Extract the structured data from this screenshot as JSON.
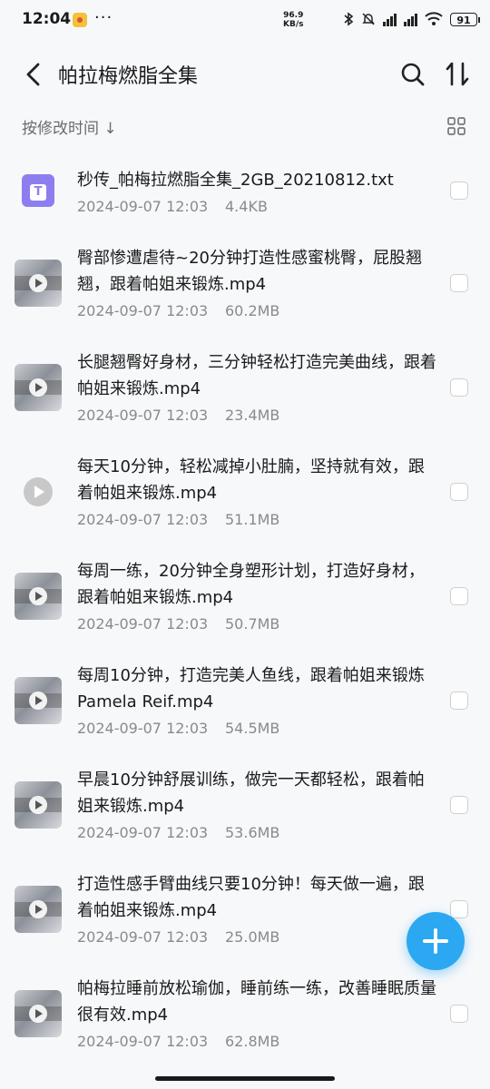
{
  "status_bar": {
    "time": "12:04",
    "more": "···",
    "net_speed_value": "96.9",
    "net_speed_unit": "KB/s",
    "battery": "91"
  },
  "header": {
    "title": "帕拉梅燃脂全集",
    "back_icon": "chevron-left-icon",
    "search_icon": "search-icon",
    "sort_icon": "sort-icon"
  },
  "subheader": {
    "sort_label": "按修改时间 ↓",
    "view_icon": "grid-view-icon"
  },
  "files": [
    {
      "name": "秒传_帕梅拉燃脂全集_2GB_20210812.txt",
      "date": "2024-09-07 12:03",
      "size": "4.4KB",
      "type": "txt"
    },
    {
      "name": "臀部惨遭虐待~20分钟打造性感蜜桃臀，屁股翘翘，跟着帕姐来锻炼.mp4",
      "date": "2024-09-07 12:03",
      "size": "60.2MB",
      "type": "video"
    },
    {
      "name": "长腿翘臀好身材，三分钟轻松打造完美曲线，跟着帕姐来锻炼.mp4",
      "date": "2024-09-07 12:03",
      "size": "23.4MB",
      "type": "video"
    },
    {
      "name": "每天10分钟，轻松减掉小肚腩，坚持就有效，跟着帕姐来锻炼.mp4",
      "date": "2024-09-07 12:03",
      "size": "51.1MB",
      "type": "video-plain"
    },
    {
      "name": "每周一练，20分钟全身塑形计划，打造好身材，跟着帕姐来锻炼.mp4",
      "date": "2024-09-07 12:03",
      "size": "50.7MB",
      "type": "video"
    },
    {
      "name": "每周10分钟，打造完美人鱼线，跟着帕姐来锻炼Pamela Reif.mp4",
      "date": "2024-09-07 12:03",
      "size": "54.5MB",
      "type": "video"
    },
    {
      "name": "早晨10分钟舒展训练，做完一天都轻松，跟着帕姐来锻炼.mp4",
      "date": "2024-09-07 12:03",
      "size": "53.6MB",
      "type": "video"
    },
    {
      "name": "打造性感手臂曲线只要10分钟！每天做一遍，跟着帕姐来锻炼.mp4",
      "date": "2024-09-07 12:03",
      "size": "25.0MB",
      "type": "video"
    },
    {
      "name": "帕梅拉睡前放松瑜伽，睡前练一练，改善睡眠质量很有效.mp4",
      "date": "2024-09-07 12:03",
      "size": "62.8MB",
      "type": "video"
    }
  ],
  "fab_icon": "plus-icon",
  "colors": {
    "accent": "#2ba8f1",
    "txt_icon": "#8d7ef0",
    "background": "#f7f8fa"
  }
}
